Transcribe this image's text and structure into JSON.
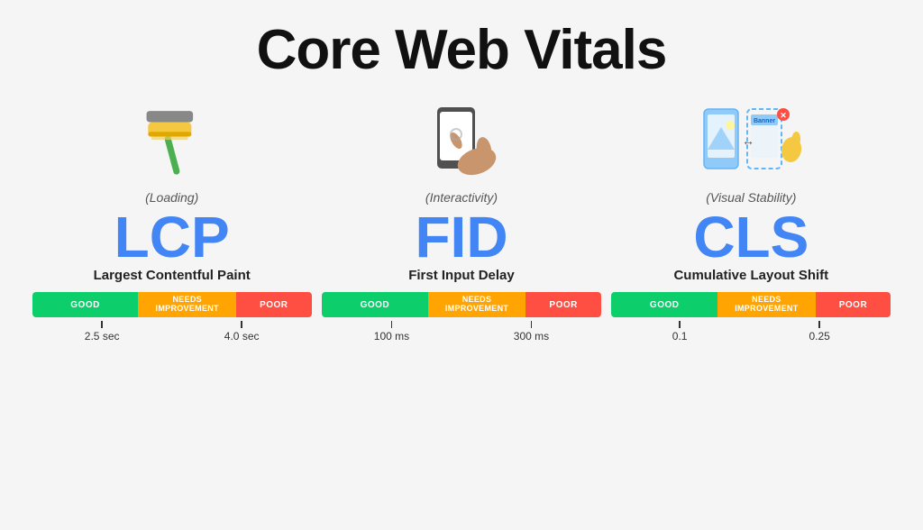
{
  "page": {
    "title": "Core Web Vitals",
    "bg_color": "#f5f5f5"
  },
  "metrics": [
    {
      "id": "lcp",
      "subtitle": "(Loading)",
      "acronym": "LCP",
      "description": "Largest Contentful Paint",
      "bar": {
        "good_label": "GOOD",
        "needs_label": "NEEDS\nIMPROVEMENT",
        "poor_label": "POOR",
        "good_width": 38,
        "needs_width": 35,
        "poor_width": 27
      },
      "thresholds": [
        "2.5 sec",
        "4.0 sec"
      ]
    },
    {
      "id": "fid",
      "subtitle": "(Interactivity)",
      "acronym": "FID",
      "description": "First Input Delay",
      "bar": {
        "good_label": "GOOD",
        "needs_label": "NEEDS\nIMPROVEMENT",
        "poor_label": "POOR",
        "good_width": 38,
        "needs_width": 35,
        "poor_width": 27
      },
      "thresholds": [
        "100 ms",
        "300 ms"
      ]
    },
    {
      "id": "cls",
      "subtitle": "(Visual Stability)",
      "acronym": "CLS",
      "description": "Cumulative Layout Shift",
      "bar": {
        "good_label": "GOOD",
        "needs_label": "NEEDS\nIMPROVEMENT",
        "poor_label": "POOR",
        "good_width": 38,
        "needs_width": 35,
        "poor_width": 27
      },
      "thresholds": [
        "0.1",
        "0.25"
      ]
    }
  ]
}
